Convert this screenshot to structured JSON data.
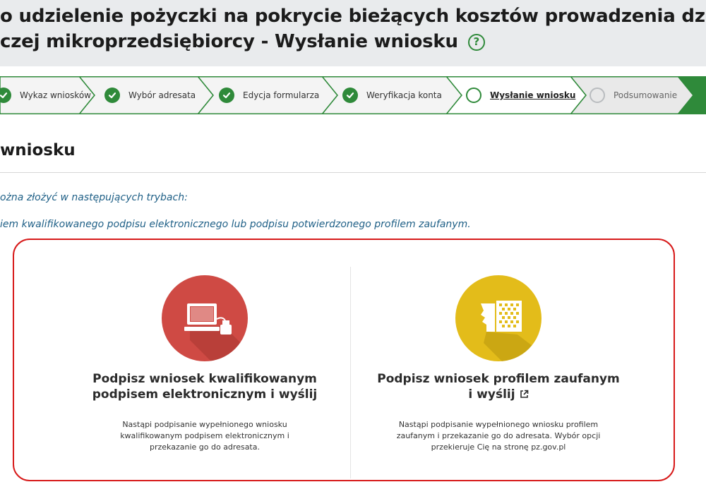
{
  "header": {
    "title_line1": "o udzielenie pożyczki na pokrycie bieżących kosztów prowadzenia działalności",
    "title_line2": "czej mikroprzedsiębiorcy - Wysłanie wniosku",
    "help_label": "?"
  },
  "stepper": {
    "steps": [
      {
        "label": "Wykaz wniosków",
        "state": "done"
      },
      {
        "label": "Wybór adresata",
        "state": "done"
      },
      {
        "label": "Edycja formularza",
        "state": "done"
      },
      {
        "label": "Weryfikacja konta",
        "state": "done"
      },
      {
        "label": "Wysłanie wniosku",
        "state": "current"
      },
      {
        "label": "Podsumowanie",
        "state": "future"
      }
    ]
  },
  "section": {
    "title": "wniosku",
    "info_line1": "ożna złożyć w następujących trybach:",
    "info_line2": "iem kwalifikowanego podpisu elektronicznego lub podpisu potwierdzonego profilem zaufanym."
  },
  "options": [
    {
      "title_line1": "Podpisz wniosek kwalifikowanym",
      "title_line2": "podpisem elektronicznym i wyślij",
      "description": "Nastąpi podpisanie wypełnionego wniosku kwalifikowanym podpisem elektronicznym i przekazanie go do adresata.",
      "icon": "computer-signature-icon"
    },
    {
      "title_line1": "Podpisz wniosek profilem zaufanym",
      "title_line2": "i wyślij",
      "description": "Nastąpi podpisanie wypełnionego wniosku profilem zaufanym i przekazanie go do adresata. Wybór opcji przekieruje Cię na stronę pz.gov.pl",
      "icon": "trusted-profile-icon"
    }
  ],
  "colors": {
    "brand_green": "#2f8a3a",
    "alert_red": "#d71a1a",
    "info_blue": "#1e5f86",
    "option1_circle": "#cf4a44",
    "option2_circle": "#e3bc1a"
  }
}
